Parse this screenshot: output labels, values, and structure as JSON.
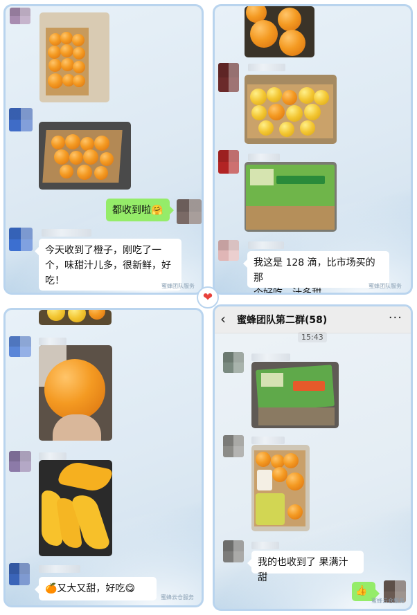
{
  "panel1": {
    "messages": [
      {
        "type": "image",
        "desc": "box of oranges"
      },
      {
        "type": "image",
        "desc": "box of oranges"
      },
      {
        "type": "text",
        "self": true,
        "text": "都收到啦🤗"
      },
      {
        "type": "text",
        "text": "今天收到了橙子，刚吃了一个，味甜汁儿多，很新鲜，好吃！"
      }
    ],
    "line1": "今天收到了橙子，刚吃了一",
    "line2": "个，味甜汁儿多，很新鲜，好",
    "line3": "吃！",
    "self_text": "都收到啦🤗",
    "watermark": "蜜蜂团队服务"
  },
  "panel2": {
    "line1": "我这是 128 滴，比市场买的那",
    "line2": "个好吃，汁多甜",
    "watermark": "蜜蜂团队服务"
  },
  "panel3": {
    "text": "🍊又大又甜，好吃😋",
    "watermark": "蜜蜂云仓服务"
  },
  "panel4": {
    "title": "蜜蜂团队第二群(58)",
    "back_icon": "‹",
    "more_icon": "···",
    "time": "15:43",
    "text": "我的也收到了 果满汁甜",
    "self_emoji": "👍",
    "watermark": "蜜蜂云仓服务"
  },
  "divider_icon": "heart-icon",
  "colors": {
    "border": "#b9d4ee",
    "self_bubble": "#95ec69",
    "heart": "#e8413b"
  }
}
